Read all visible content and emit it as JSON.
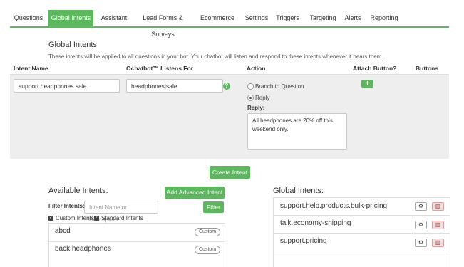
{
  "tabs": [
    {
      "label": "Questions",
      "active": false
    },
    {
      "label": "Global Intents",
      "active": true
    },
    {
      "label": "Assistant",
      "active": false
    },
    {
      "label": "Lead Forms & Surveys",
      "active": false
    },
    {
      "label": "Ecommerce",
      "active": false
    },
    {
      "label": "Settings",
      "active": false
    },
    {
      "label": "Triggers",
      "active": false
    },
    {
      "label": "Targeting",
      "active": false
    },
    {
      "label": "Alerts",
      "active": false
    },
    {
      "label": "Reporting",
      "active": false
    }
  ],
  "section": {
    "title": "Global Intents",
    "description": "These intents will be applied to all questions in your bot. Your chatbot will listen and respond to these intents whenever it hears them."
  },
  "columns": {
    "intent_name": "Intent Name",
    "listens_for": "Ochatbot™ Listens For",
    "action": "Action",
    "attach_button": "Attach Button?",
    "buttons": "Buttons"
  },
  "editor": {
    "intent_name_value": "support.headphones.sale",
    "listens_for_value": "headphones|sale",
    "help_icon": "?",
    "branch_label": "Branch to Question",
    "reply_label": "Reply",
    "reply_heading": "Reply:",
    "reply_text": "All headphones are 20% off this weekend only.",
    "add_button_icon": "+",
    "create_button": "Create Intent"
  },
  "available": {
    "title": "Available Intents:",
    "add_advanced_button": "Add Advanced Intent",
    "filter_label": "Filter Intents:",
    "filter_placeholder": "Intent Name or Description",
    "filter_button": "Filter",
    "custom_checkbox": "Custom Intents",
    "standard_checkbox": "Standard Intents",
    "items": [
      {
        "name": "abcd",
        "badge": "Custom"
      },
      {
        "name": "back.headphones",
        "badge": "Custom"
      }
    ]
  },
  "global": {
    "title": "Global Intents:",
    "items": [
      {
        "name": "support.help.products.bulk-pricing"
      },
      {
        "name": "talk.economy-shipping"
      },
      {
        "name": "support.pricing"
      }
    ]
  },
  "colors": {
    "accent": "#5cb85c",
    "panel": "#eeeeee",
    "delete": "#f2dede"
  },
  "icons": {
    "settings": "gear-icon",
    "delete": "trash-icon",
    "add": "plus-icon"
  }
}
